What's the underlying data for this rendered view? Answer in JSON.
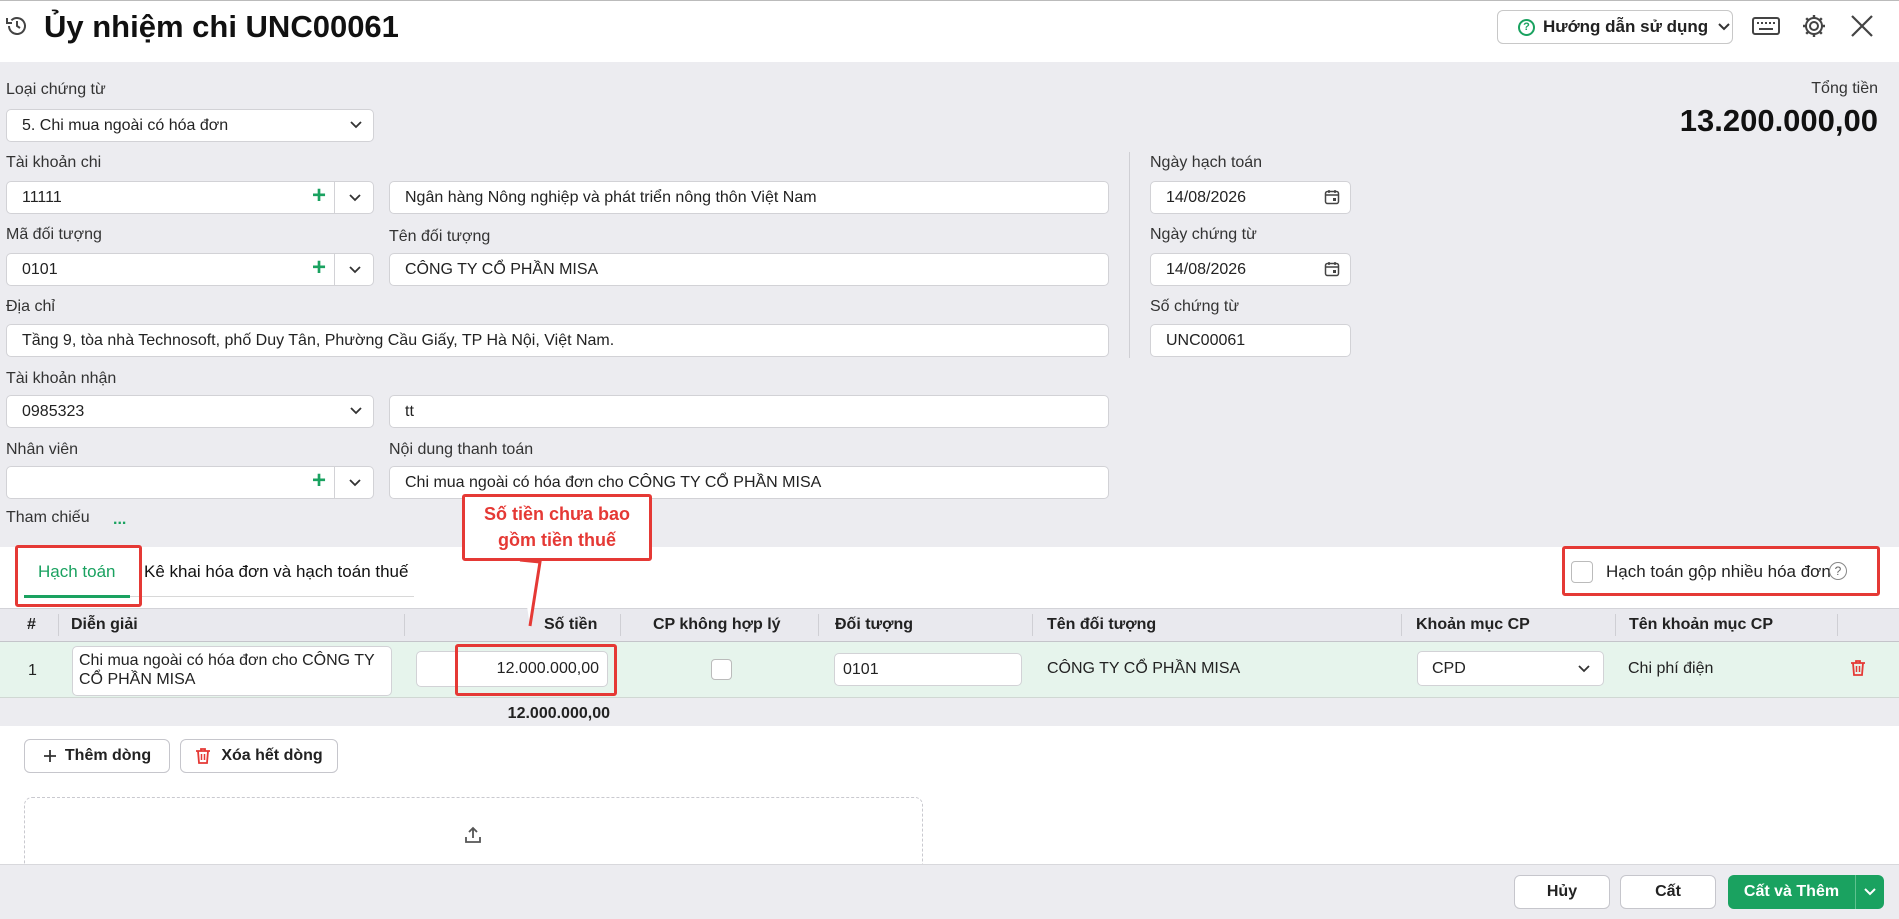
{
  "header": {
    "title": "Ủy nhiệm chi UNC00061",
    "help_label": "Hướng dẫn sử dụng"
  },
  "form": {
    "loai_chung_tu": {
      "label": "Loại chứng từ",
      "value": "5. Chi mua ngoài có hóa đơn"
    },
    "tong_tien": {
      "label": "Tổng tiền",
      "value": "13.200.000,00"
    },
    "tai_khoan_chi": {
      "label": "Tài khoản chi",
      "value": "11111",
      "bank": "Ngân hàng Nông nghiệp và phát triển nông thôn Việt Nam"
    },
    "ngay_hach_toan": {
      "label": "Ngày hạch toán",
      "value": "14/08/2026"
    },
    "ma_doi_tuong": {
      "label": "Mã đối tượng",
      "value": "0101"
    },
    "ten_doi_tuong": {
      "label": "Tên đối tượng",
      "value": "CÔNG TY CỔ PHẦN MISA"
    },
    "ngay_chung_tu": {
      "label": "Ngày chứng từ",
      "value": "14/08/2026"
    },
    "dia_chi": {
      "label": "Địa chỉ",
      "value": "Tầng 9, tòa nhà Technosoft, phố Duy Tân, Phường Cầu Giấy, TP Hà Nội, Việt Nam."
    },
    "so_chung_tu": {
      "label": "Số chứng từ",
      "value": "UNC00061"
    },
    "tai_khoan_nhan": {
      "label": "Tài khoản nhận",
      "value": "0985323",
      "extra": "tt"
    },
    "nhan_vien": {
      "label": "Nhân viên",
      "value": ""
    },
    "noi_dung": {
      "label": "Nội dung thanh toán",
      "value": "Chi mua ngoài có hóa đơn cho  CÔNG TY CỔ PHẦN MISA"
    },
    "tham_chieu": {
      "label": "Tham chiếu",
      "dots": "..."
    }
  },
  "tabs": {
    "hach_toan": "Hạch toán",
    "ke_khai": "Kê khai hóa đơn và hạch toán thuế",
    "merge_label": "Hạch toán gộp nhiều hóa đơn",
    "merge_help": "?"
  },
  "table": {
    "headers": [
      "#",
      "Diễn giải",
      "Số tiền",
      "CP không hợp lý",
      "Đối tượng",
      "Tên đối tượng",
      "Khoản mục CP",
      "Tên khoản mục CP"
    ],
    "row": {
      "index": "1",
      "dien_giai_1": "Chi mua ngoài có hóa đơn cho  CÔNG TY",
      "dien_giai_2": "CỔ PHẦN MISA",
      "so_tien": "12.000.000,00",
      "doi_tuong": "0101",
      "ten_doi_tuong": "CÔNG TY CỔ PHẦN MISA",
      "khoan_muc": "CPD",
      "ten_khoan_muc": "Chi phí điện"
    },
    "sum": "12.000.000,00"
  },
  "actions": {
    "add_row": "Thêm dòng",
    "delete_all": "Xóa hết dòng"
  },
  "footer": {
    "cancel": "Hủy",
    "save": "Cất",
    "save_add": "Cất và Thêm"
  },
  "callout": {
    "line1": "Số tiền chưa bao",
    "line2": "gồm tiền thuế"
  },
  "colors": {
    "accent": "#1aa260",
    "annotation": "#e53935"
  }
}
